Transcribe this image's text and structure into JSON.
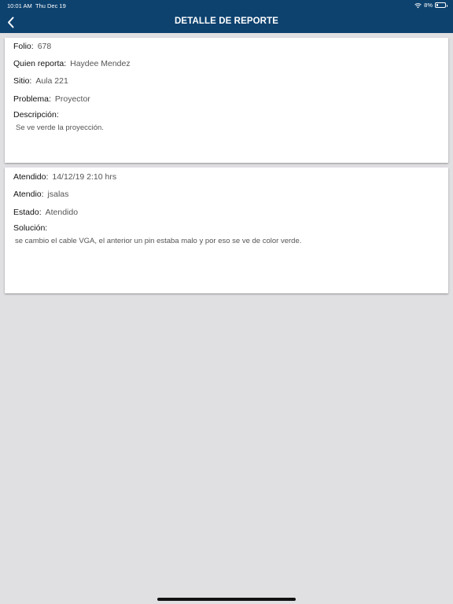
{
  "status_bar": {
    "time": "10:01 AM",
    "date": "Thu Dec 19",
    "battery": "8%",
    "icons": [
      "wifi-icon",
      "battery-icon"
    ]
  },
  "navbar": {
    "title": "DETALLE DE REPORTE",
    "back_icon": "chevron-left-icon"
  },
  "report": {
    "folio_label": "Folio:",
    "folio": "678",
    "reporter_label": "Quien reporta:",
    "reporter": "Haydee Mendez",
    "site_label": "Sitio:",
    "site": "Aula 221",
    "problem_label": "Problema:",
    "problem": "Proyector",
    "description_label": "Descripción:",
    "description": "Se ve verde la proyección."
  },
  "resolution": {
    "attended_at_label": "Atendido:",
    "attended_at": "14/12/19 2:10 hrs",
    "attended_by_label": "Atendio:",
    "attended_by": "jsalas",
    "status_label": "Estado:",
    "status": "Atendido",
    "solution_label": "Solución:",
    "solution": "se cambio el cable VGA, el anterior un pin estaba malo y por eso se ve de color verde."
  },
  "colors": {
    "navbar": "#0d426f",
    "background": "#e0dfe2",
    "card": "#ffffff"
  }
}
